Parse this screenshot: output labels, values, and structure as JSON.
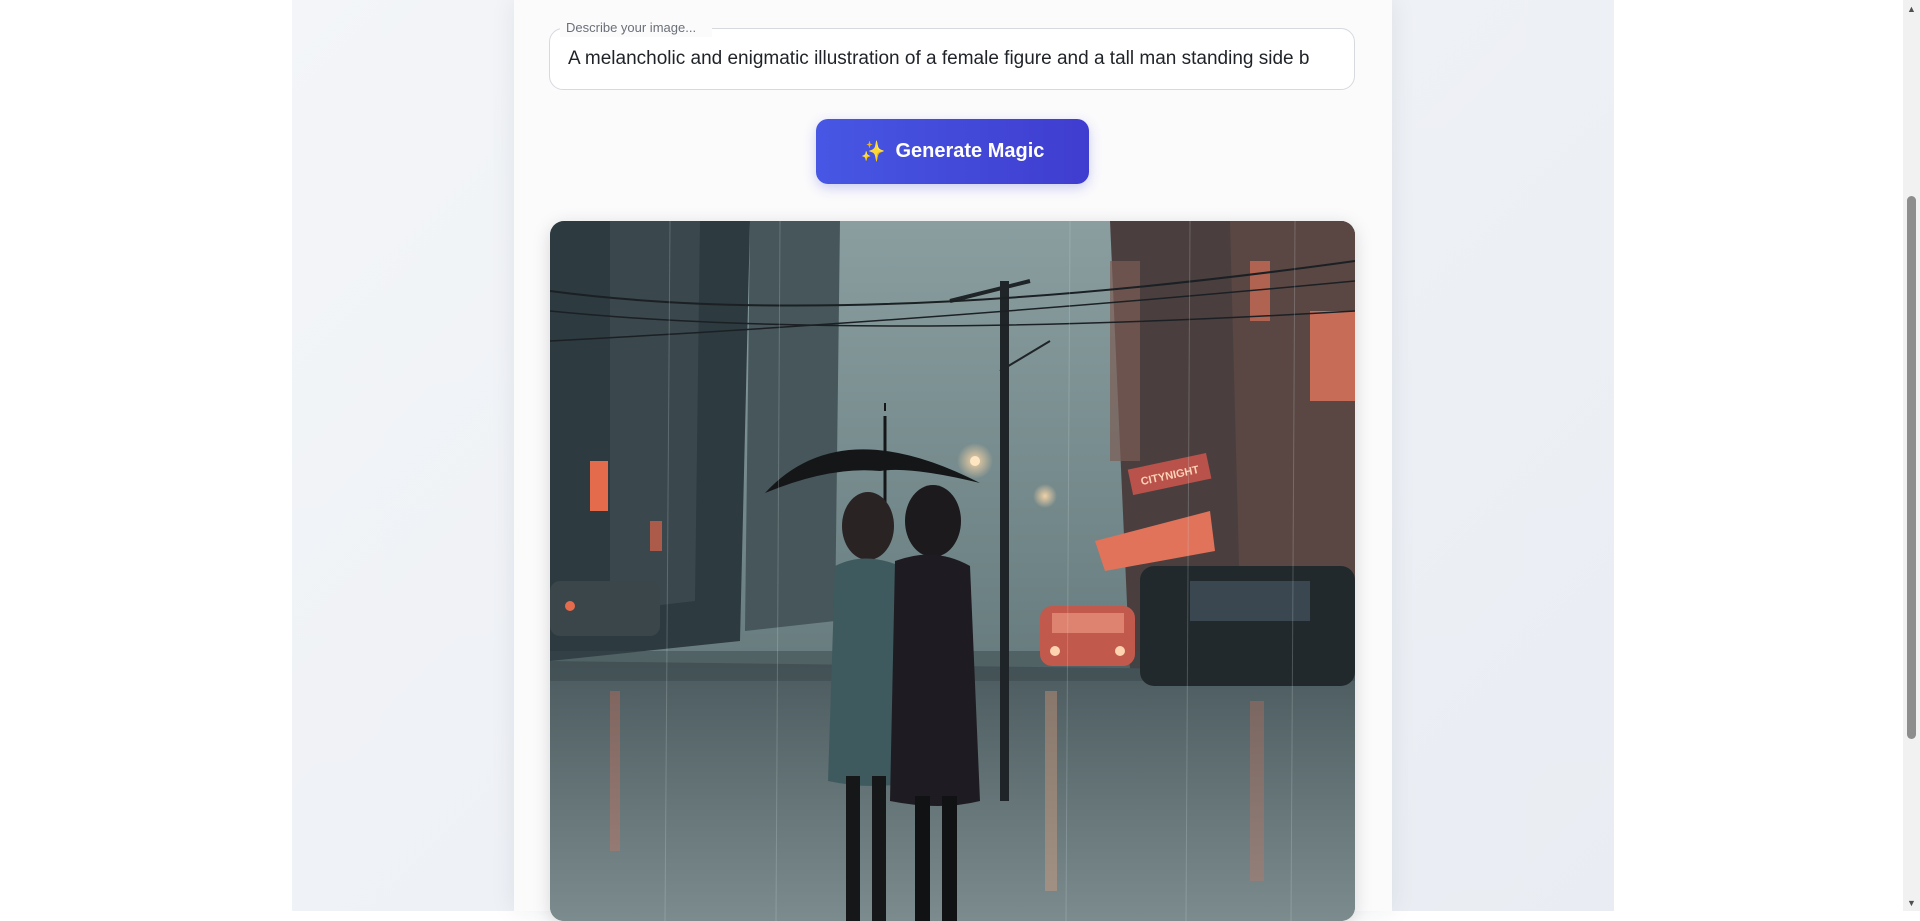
{
  "prompt_field": {
    "label": "Describe your image...",
    "value": "A melancholic and enigmatic illustration of a female figure and a tall man standing side b"
  },
  "generate_button": {
    "icon": "sparkles-icon",
    "icon_glyph": "✨",
    "label": "Generate Magic"
  },
  "generated_image": {
    "sign_text": "CITYNIGHT"
  },
  "colors": {
    "button_start": "#4757e4",
    "button_end": "#3f3dcf",
    "page_background": "#eef1f5"
  }
}
